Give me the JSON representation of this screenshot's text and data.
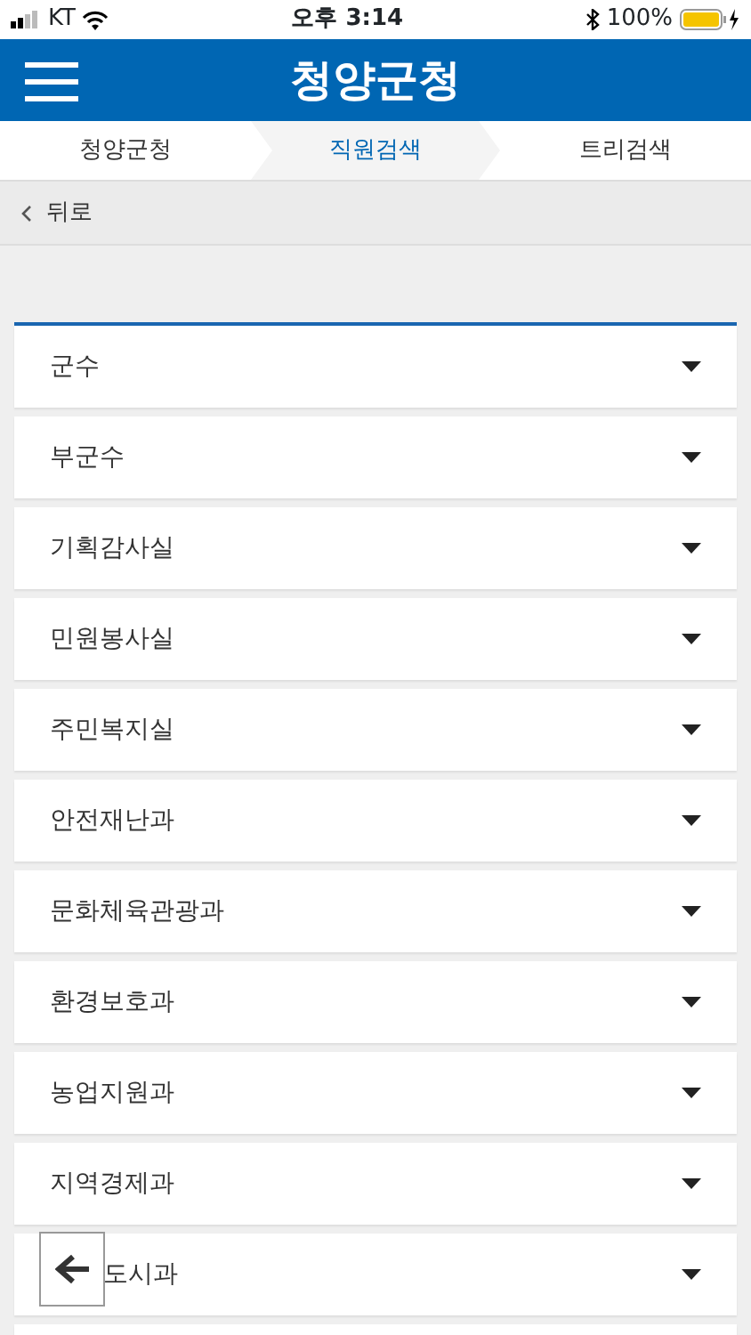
{
  "status_bar": {
    "carrier": "KT",
    "time": "오후 3:14",
    "battery": "100%"
  },
  "header": {
    "title": "청양군청"
  },
  "tabs": [
    {
      "label": "청양군청",
      "selected": false
    },
    {
      "label": "직원검색",
      "selected": true
    },
    {
      "label": "트리검색",
      "selected": false
    }
  ],
  "back_link": {
    "label": "뒤로"
  },
  "departments": [
    {
      "label": "군수",
      "covered": false
    },
    {
      "label": "부군수",
      "covered": false
    },
    {
      "label": "기획감사실",
      "covered": false
    },
    {
      "label": "민원봉사실",
      "covered": false
    },
    {
      "label": "주민복지실",
      "covered": false
    },
    {
      "label": "안전재난과",
      "covered": false
    },
    {
      "label": "문화체육관광과",
      "covered": false
    },
    {
      "label": "환경보호과",
      "covered": false
    },
    {
      "label": "농업지원과",
      "covered": false
    },
    {
      "label": "지역경제과",
      "covered": false
    },
    {
      "label": "도시과",
      "covered": true
    }
  ]
}
